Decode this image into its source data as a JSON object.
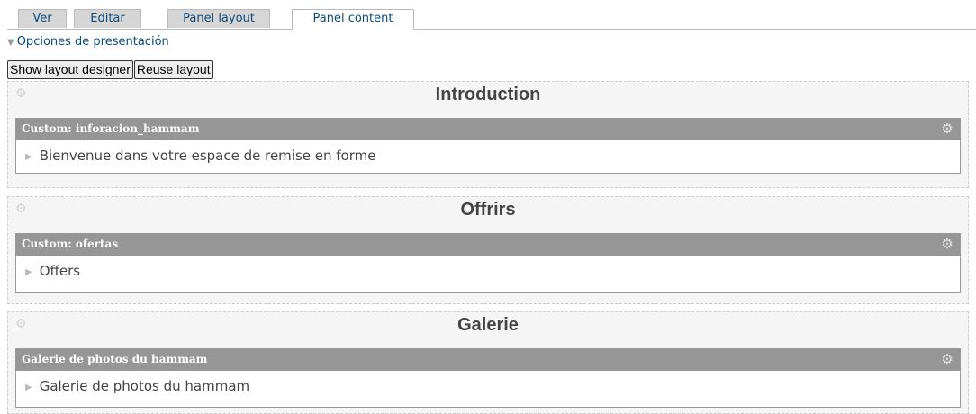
{
  "tabs": [
    {
      "label": "Ver"
    },
    {
      "label": "Editar"
    },
    {
      "label": "Panel layout"
    },
    {
      "label": "Panel content",
      "active": true
    }
  ],
  "display_options": {
    "label": "Opciones de presentación"
  },
  "buttons": {
    "show_layout_designer": "Show layout designer",
    "reuse_layout": "Reuse layout"
  },
  "regions": [
    {
      "title": "Introduction",
      "pane": {
        "title": "Custom: inforacion_hammam",
        "content": "Bienvenue dans votre espace de remise en forme"
      }
    },
    {
      "title": "Offrirs",
      "pane": {
        "title": "Custom: ofertas",
        "content": "Offers"
      }
    },
    {
      "title": "Galerie",
      "pane": {
        "title": "Galerie de photos du hammam",
        "content": "Galerie de photos du hammam"
      }
    }
  ],
  "icons": {
    "region_settings": "gear-icon",
    "pane_settings": "gear-icon",
    "collapse": "triangle-right-icon"
  }
}
